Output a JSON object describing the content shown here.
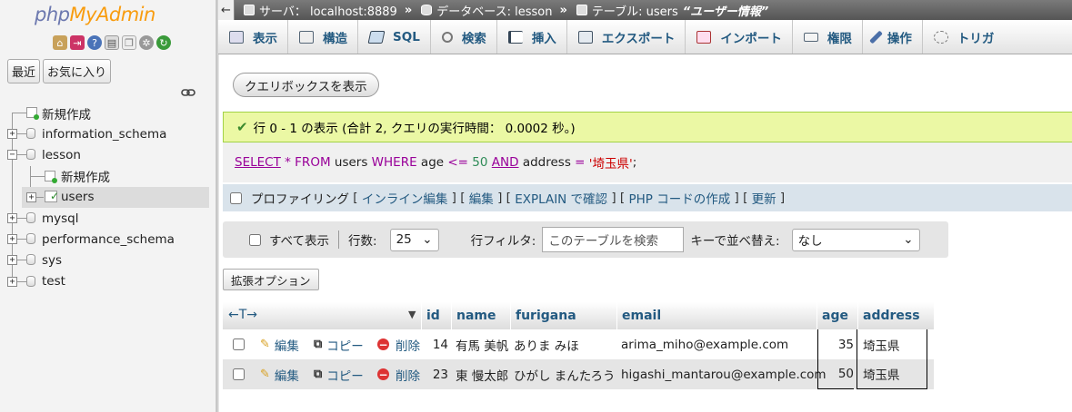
{
  "app": {
    "logo_php": "php",
    "logo_myadmin": "MyAdmin"
  },
  "nav": {
    "tabs": [
      {
        "label": "最近"
      },
      {
        "label": "お気に入り"
      }
    ],
    "tree": [
      {
        "label": "新規作成",
        "type": "new",
        "level": 0
      },
      {
        "label": "information_schema",
        "type": "db",
        "level": 0
      },
      {
        "label": "lesson",
        "type": "db",
        "level": 0,
        "expanded": true
      },
      {
        "label": "新規作成",
        "type": "new",
        "level": 1
      },
      {
        "label": "users",
        "type": "table",
        "level": 1,
        "selected": true
      },
      {
        "label": "mysql",
        "type": "db",
        "level": 0
      },
      {
        "label": "performance_schema",
        "type": "db",
        "level": 0
      },
      {
        "label": "sys",
        "type": "db",
        "level": 0
      },
      {
        "label": "test",
        "type": "db",
        "level": 0
      }
    ]
  },
  "breadcrumb": {
    "server": "サーバ： localhost:8889",
    "database": "データベース: lesson",
    "table": "テーブル: users",
    "table_comment": "“ユーザー情報”"
  },
  "menu": [
    {
      "label": "表示",
      "icon": "browse-icon"
    },
    {
      "label": "構造",
      "icon": "structure-icon"
    },
    {
      "label": "SQL",
      "icon": "sql-icon"
    },
    {
      "label": "検索",
      "icon": "search-icon"
    },
    {
      "label": "挿入",
      "icon": "insert-icon"
    },
    {
      "label": "エクスポート",
      "icon": "export-icon"
    },
    {
      "label": "インポート",
      "icon": "import-icon"
    },
    {
      "label": "権限",
      "icon": "privileges-icon"
    },
    {
      "label": "操作",
      "icon": "operations-icon"
    },
    {
      "label": "トリガ",
      "icon": "triggers-icon"
    }
  ],
  "query_box_button": "クエリボックスを表示",
  "success_message": "行 0 - 1 の表示 (合計 2, クエリの実行時間： 0.0002 秒。)",
  "sql": {
    "select": "SELECT",
    "star": "*",
    "from": "FROM",
    "table": "users",
    "where": "WHERE",
    "col1": "age",
    "op1": "<=",
    "val1": "50",
    "and": "AND",
    "col2": "address",
    "op2": "=",
    "val2": "'埼玉県'",
    "end": ";"
  },
  "profiling": {
    "label": "プロファイリング",
    "links": [
      "インライン編集",
      "編集",
      "EXPLAIN で確認",
      "PHP コードの作成",
      "更新"
    ]
  },
  "navigation": {
    "show_all": "すべて表示",
    "rows_label": "行数:",
    "rows_value": "25",
    "filter_label": "行フィルタ:",
    "filter_placeholder": "このテーブルを検索",
    "sort_label": "キーで並べ替え:",
    "sort_value": "なし"
  },
  "extra_options": "拡張オプション",
  "table": {
    "arrows": "←T→",
    "columns": [
      "id",
      "name",
      "furigana",
      "email",
      "age",
      "address"
    ],
    "actions": {
      "edit": "編集",
      "copy": "コピー",
      "delete": "削除"
    },
    "rows": [
      {
        "id": "14",
        "name": "有馬 美帆",
        "furigana": "ありま みほ",
        "email": "arima_miho@example.com",
        "age": "35",
        "address": "埼玉県"
      },
      {
        "id": "23",
        "name": "東 慢太郎",
        "furigana": "ひがし まんたろう",
        "email": "higashi_mantarou@example.com",
        "age": "50",
        "address": "埼玉県"
      }
    ]
  },
  "colors": {
    "link": "#235a81",
    "success_bg": "#ebf8a4",
    "sql_keyword": "#990099",
    "sql_string": "#cc0000",
    "sql_number": "#2e8b57"
  }
}
